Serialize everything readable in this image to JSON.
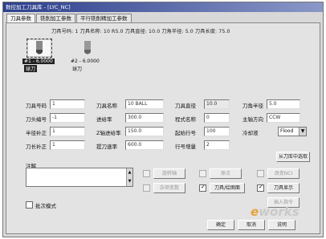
{
  "window": {
    "title": "数控加工刀具库 - [LYC_NC]"
  },
  "tabs": [
    {
      "label": "刀具参数",
      "active": true
    },
    {
      "label": "铣削加工参数",
      "active": false
    },
    {
      "label": "平行铣削精加工参数",
      "active": false
    }
  ],
  "toolbar": {
    "text": "刀具号码: 1  刀具名称: 10 R5.0  刀具直径: 10.0  刀角半径: 5.0  刀具长度: 75.0"
  },
  "tools": [
    {
      "line1": "#1 - 6.0000",
      "line2": "球刀",
      "selected": true
    },
    {
      "line1": "#2 - 6.0000",
      "line2": "球刀",
      "selected": false
    }
  ],
  "fields": {
    "tool_number": {
      "label": "刀具号码",
      "value": "1"
    },
    "tool_name": {
      "label": "刀具名称",
      "value": "10 BALL"
    },
    "tool_diameter": {
      "label": "刀具直径",
      "value": "10.0"
    },
    "corner_radius": {
      "label": "刀角半径",
      "value": "5.0"
    },
    "head_number": {
      "label": "刀头编号",
      "value": "-1"
    },
    "feed_rate": {
      "label": "进给率",
      "value": "300.0"
    },
    "program_name": {
      "label": "程式名称",
      "value": "0"
    },
    "spindle_dir": {
      "label": "主轴方向",
      "value": "CCW"
    },
    "radius_comp": {
      "label": "半径补正",
      "value": "1"
    },
    "plunge_rate": {
      "label": "Z轴进给率",
      "value": "150.0"
    },
    "start_line": {
      "label": "起始行号",
      "value": "100"
    },
    "coolant": {
      "label": "冷却液",
      "value": "Flood"
    },
    "length_comp": {
      "label": "刀长补正",
      "value": "1"
    },
    "retract_rate": {
      "label": "提刀速率",
      "value": "600.0"
    },
    "line_incr": {
      "label": "行号增量",
      "value": "2"
    }
  },
  "buttons": {
    "select_library": "从刀库中选取",
    "rotary_axis": "旋转轴",
    "tool_display": "刀具显示",
    "change_nci": "改变NCI",
    "origin": "原点",
    "tool_plane": "刀具/绘图面",
    "misc_values": "杂项变数",
    "insert_instr": "插入指令",
    "ok": "确定",
    "cancel": "取消",
    "help": "说明"
  },
  "notes": {
    "label": "注解"
  },
  "batch_mode": {
    "label": "批次模式"
  },
  "checks": {
    "rotary_axis": false,
    "tool_plane": true,
    "origin": false,
    "tool_display": true
  },
  "logo": {
    "text": "works",
    "prefix": "e"
  }
}
